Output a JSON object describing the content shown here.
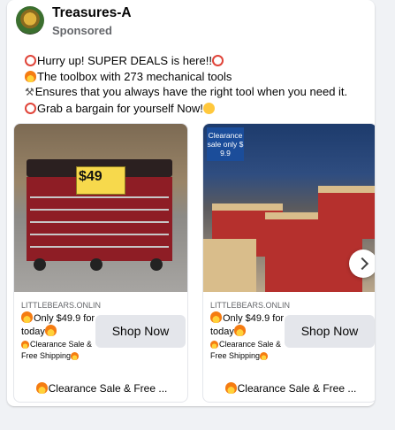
{
  "post": {
    "page_name": "Treasures-A",
    "sponsored": "Sponsored",
    "lines": [
      "Hurry up! SUPER DEALS is here!!",
      "The toolbox with 273 mechanical tools",
      "Ensures that you always have the right tool when you need it.",
      "Grab a bargain for yourself Now!"
    ]
  },
  "carousel": {
    "items": [
      {
        "image_price": "$49",
        "source": "LITTLEBEARS.ONLIN",
        "offer": "Only $49.9 for today",
        "details": "Clearance Sale & Free Shipping",
        "cta": "Shop Now",
        "caption": "Clearance Sale & Free ..."
      },
      {
        "image_badge": "Clearance sale only $ 9.9",
        "source": "LITTLEBEARS.ONLIN",
        "offer": "Only $49.9 for today",
        "details": "Clearance Sale & Free Shipping",
        "cta": "Shop Now",
        "caption": "Clearance Sale & Free ..."
      }
    ]
  }
}
